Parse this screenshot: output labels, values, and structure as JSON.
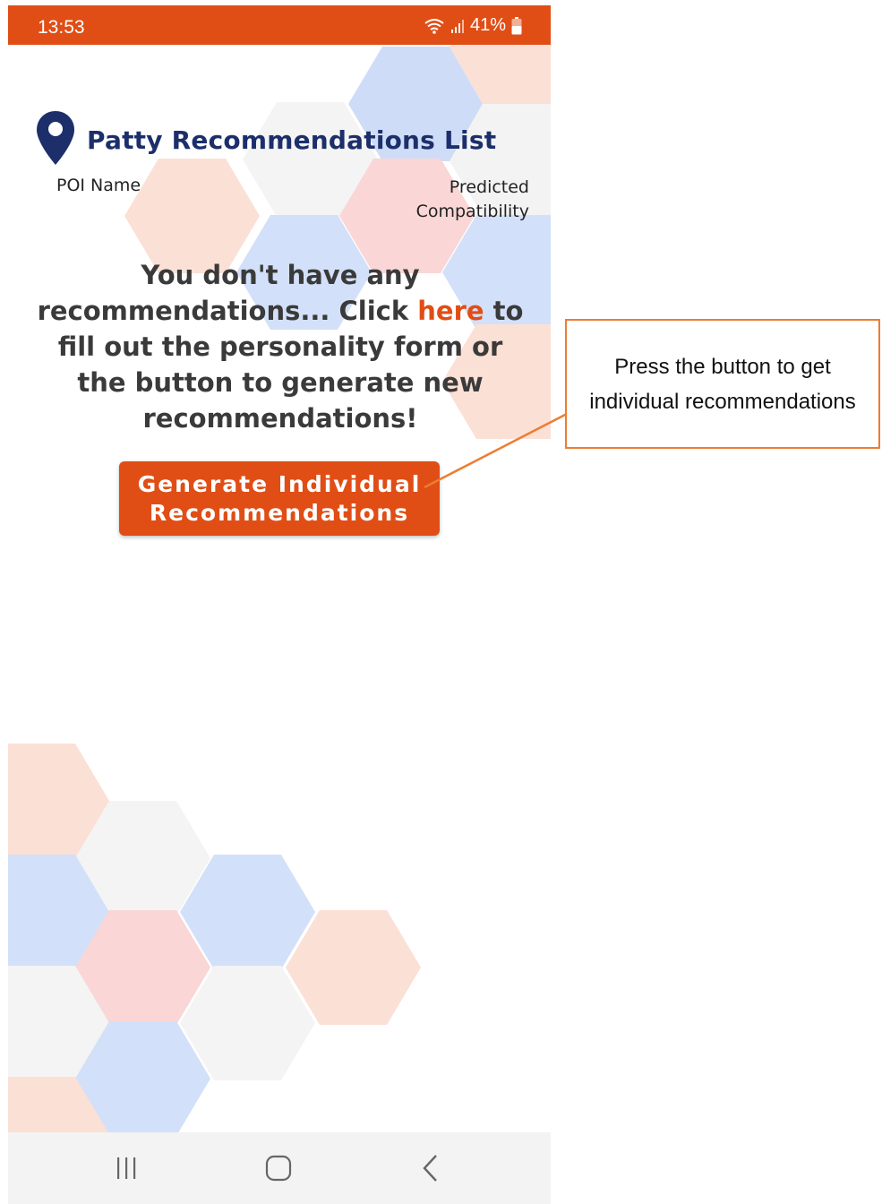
{
  "status_bar": {
    "time": "13:53",
    "battery_percent": "41%",
    "color": "#e04e16"
  },
  "header": {
    "title": "Patty Recommendations List",
    "icon": "location-pin-icon"
  },
  "columns": {
    "poi_name": "POI Name",
    "compatibility": "Predicted Compatibility"
  },
  "empty_state": {
    "text_before": "You don't have any recommendations... Click ",
    "link_text": "here",
    "text_after": " to fill out the personality form or the button to generate new recommendations!"
  },
  "generate_button": {
    "label": "Generate Individual Recommendations"
  },
  "nav_bar": {
    "recents_icon": "recents-icon",
    "home_icon": "home-icon",
    "back_icon": "back-icon"
  },
  "annotation": {
    "text": "Press the button to get individual recommendations",
    "border_color": "#ed7d31"
  },
  "colors": {
    "accent": "#e04e16",
    "title": "#1c2f6b"
  }
}
